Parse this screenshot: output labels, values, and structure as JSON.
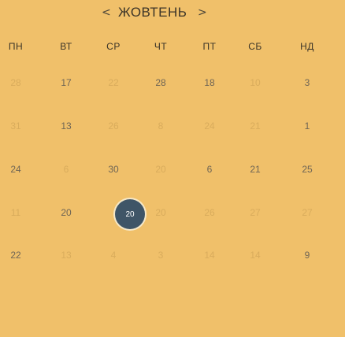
{
  "header": {
    "month": "ЖОВТЕНЬ",
    "prev_icon": "chevron-left-icon",
    "next_icon": "chevron-right-icon",
    "prev_glyph": "<",
    "next_glyph": ">"
  },
  "weekdays": [
    "ПН",
    "ВТ",
    "СР",
    "ЧТ",
    "ПТ",
    "СБ",
    "НД"
  ],
  "weeks": [
    [
      {
        "d": "28",
        "cur": false
      },
      {
        "d": "17",
        "cur": true
      },
      {
        "d": "22",
        "cur": false
      },
      {
        "d": "28",
        "cur": true
      },
      {
        "d": "18",
        "cur": true
      },
      {
        "d": "10",
        "cur": false
      },
      {
        "d": "3",
        "cur": true
      }
    ],
    [
      {
        "d": "31",
        "cur": false
      },
      {
        "d": "13",
        "cur": true
      },
      {
        "d": "26",
        "cur": false
      },
      {
        "d": "8",
        "cur": false
      },
      {
        "d": "24",
        "cur": false
      },
      {
        "d": "21",
        "cur": false
      },
      {
        "d": "1",
        "cur": true
      }
    ],
    [
      {
        "d": "24",
        "cur": true
      },
      {
        "d": "6",
        "cur": false
      },
      {
        "d": "30",
        "cur": true
      },
      {
        "d": "20",
        "cur": false
      },
      {
        "d": "6",
        "cur": true
      },
      {
        "d": "21",
        "cur": true
      },
      {
        "d": "25",
        "cur": true
      }
    ],
    [
      {
        "d": "11",
        "cur": false
      },
      {
        "d": "20",
        "cur": true
      },
      {
        "d": "20",
        "cur": false,
        "selected": true
      },
      {
        "d": "20",
        "cur": false
      },
      {
        "d": "26",
        "cur": false
      },
      {
        "d": "27",
        "cur": false
      },
      {
        "d": "27",
        "cur": false
      }
    ],
    [
      {
        "d": "22",
        "cur": true
      },
      {
        "d": "13",
        "cur": false
      },
      {
        "d": "4",
        "cur": false
      },
      {
        "d": "3",
        "cur": false
      },
      {
        "d": "14",
        "cur": false
      },
      {
        "d": "14",
        "cur": false
      },
      {
        "d": "9",
        "cur": true
      }
    ]
  ],
  "colors": {
    "background": "#f0c06a",
    "selected": "#3f5567",
    "current_text": "#6f6555",
    "other_month_text": "#d9ac5c"
  }
}
